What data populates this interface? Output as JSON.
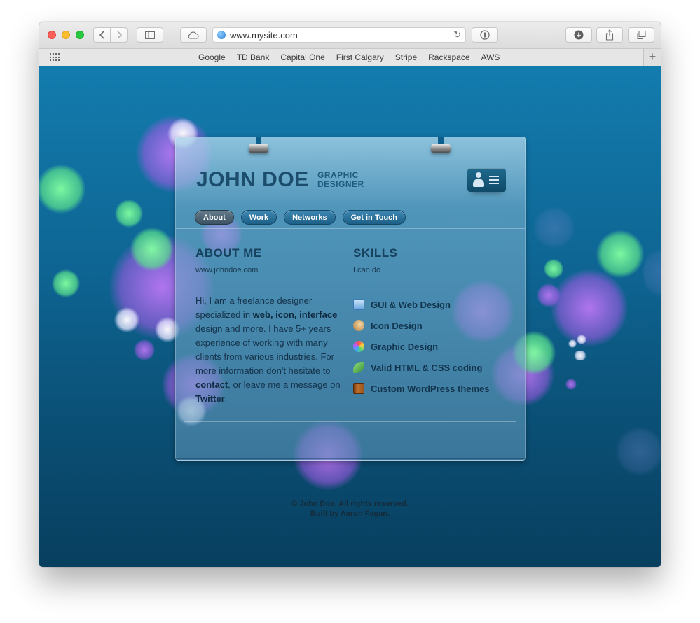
{
  "browser": {
    "url": "www.mysite.com",
    "bookmarks": [
      "Google",
      "TD Bank",
      "Capital One",
      "First Calgary",
      "Stripe",
      "Rackspace",
      "AWS"
    ],
    "new_tab_label": "+"
  },
  "header": {
    "name": "JOHN DOE",
    "role_line1": "GRAPHIC",
    "role_line2": "DESIGNER"
  },
  "nav": {
    "items": [
      "About",
      "Work",
      "Networks",
      "Get in Touch"
    ],
    "active": "About"
  },
  "about": {
    "title": "ABOUT ME",
    "subtitle": "www.johndoe.com",
    "p1": "Hi, I am a freelance designer specialized in ",
    "b1": "web, icon, interface",
    "p2": " design and more. I have 5+ years experience of working with many clients from various industries. For more information don't hesitate to ",
    "b2": "contact",
    "p3": ", or leave me a message on ",
    "b3": "Twitter",
    "p4": "."
  },
  "skills": {
    "title": "SKILLS",
    "subtitle": "I can do",
    "items": [
      {
        "label": "GUI & Web Design",
        "icon": "browser-window-icon"
      },
      {
        "label": "Icon Design",
        "icon": "palette-icon"
      },
      {
        "label": "Graphic Design",
        "icon": "color-wheel-icon"
      },
      {
        "label": "Valid HTML & CSS coding",
        "icon": "leaf-icon"
      },
      {
        "label": "Custom WordPress themes",
        "icon": "book-icon"
      }
    ]
  },
  "footer": {
    "line1": "© John Doe. All rights reserved.",
    "line2": "Built by Aaron Fagan."
  }
}
